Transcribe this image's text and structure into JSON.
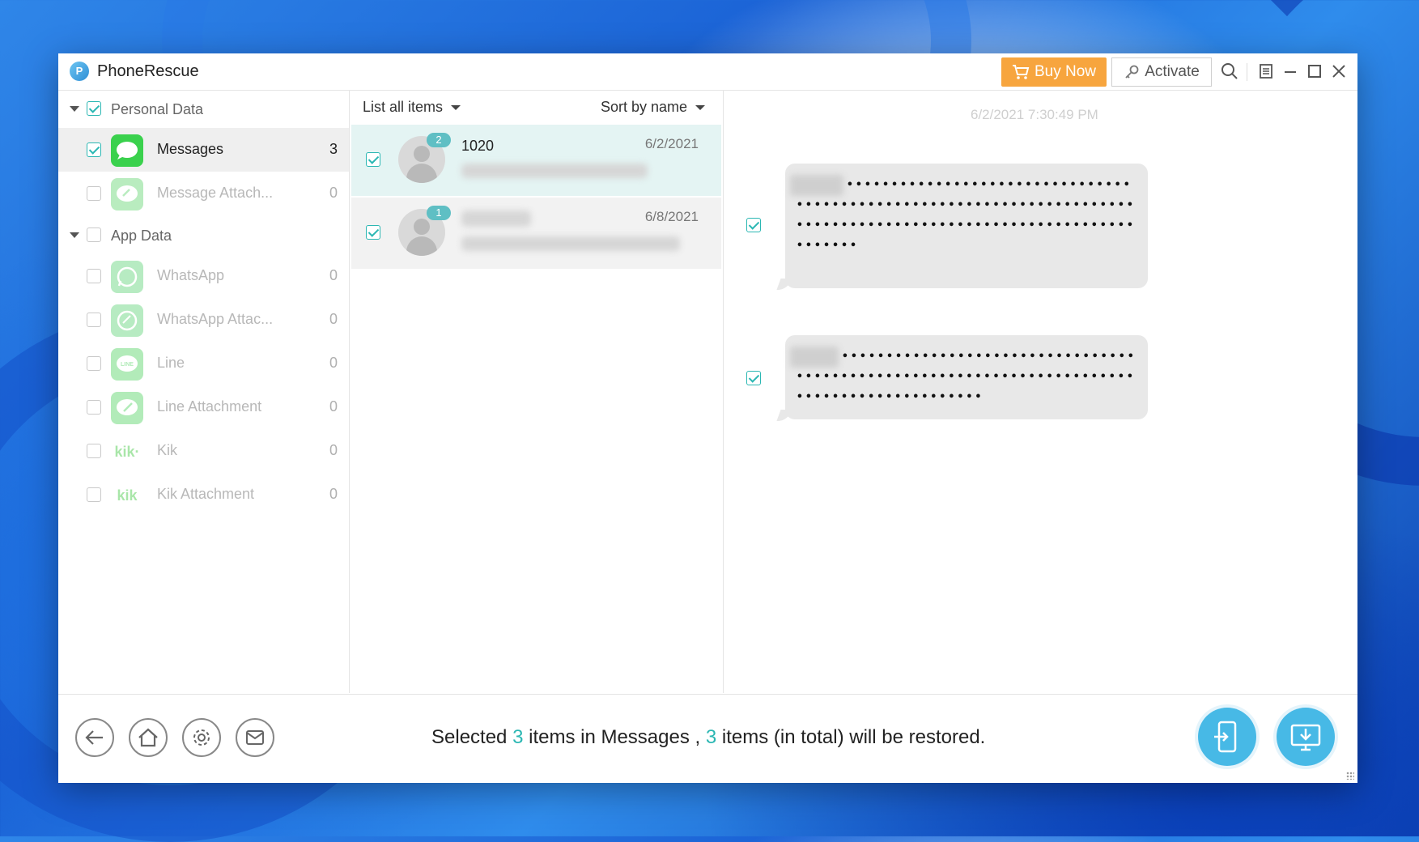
{
  "app": {
    "title": "PhoneRescue",
    "logo_letter": "P",
    "buy_now": "Buy Now",
    "activate": "Activate"
  },
  "sidebar": {
    "groups": [
      {
        "label": "Personal Data",
        "checked": true,
        "items": [
          {
            "label": "Messages",
            "count": "3",
            "checked": true,
            "active": true,
            "icon": "messages-icon"
          },
          {
            "label": "Message Attach...",
            "count": "0",
            "checked": false,
            "icon": "message-attachment-icon"
          }
        ]
      },
      {
        "label": "App Data",
        "checked": false,
        "items": [
          {
            "label": "WhatsApp",
            "count": "0",
            "checked": false,
            "icon": "whatsapp-icon"
          },
          {
            "label": "WhatsApp Attac...",
            "count": "0",
            "checked": false,
            "icon": "whatsapp-attachment-icon"
          },
          {
            "label": "Line",
            "count": "0",
            "checked": false,
            "icon": "line-icon"
          },
          {
            "label": "Line Attachment",
            "count": "0",
            "checked": false,
            "icon": "line-attachment-icon"
          },
          {
            "label": "Kik",
            "count": "0",
            "checked": false,
            "icon": "kik-icon"
          },
          {
            "label": "Kik Attachment",
            "count": "0",
            "checked": false,
            "icon": "kik-attachment-icon"
          }
        ]
      }
    ]
  },
  "list": {
    "filter": "List all items",
    "sort": "Sort by name",
    "conversations": [
      {
        "name": "1020",
        "date": "6/2/2021",
        "badge": "2",
        "checked": true
      },
      {
        "name": "",
        "date": "6/8/2021",
        "badge": "1",
        "checked": true
      }
    ]
  },
  "detail": {
    "timestamp": "6/2/2021 7:30:49 PM",
    "messages": [
      {
        "text": "•••••••••••••••••••••••••••••••••••••••••••••••••••••••••••••••••••••••••••••••••••••••••••••••••••••••••••••••••••",
        "checked": true
      },
      {
        "text": "••••••••••••••••••••••••••••••••••••••••••••••••••••••••••••••••••••••••••••••••••••••••••••",
        "checked": true
      }
    ]
  },
  "bottom": {
    "status_prefix": "Selected ",
    "selected_count": "3",
    "status_middle": " items in Messages , ",
    "total_count": "3",
    "status_suffix": " items (in total) will be restored."
  },
  "colors": {
    "accent": "#2bb7b3",
    "buy_now": "#f7a53e",
    "action_button": "#47b9e6",
    "selected_row": "#e4f4f3"
  }
}
